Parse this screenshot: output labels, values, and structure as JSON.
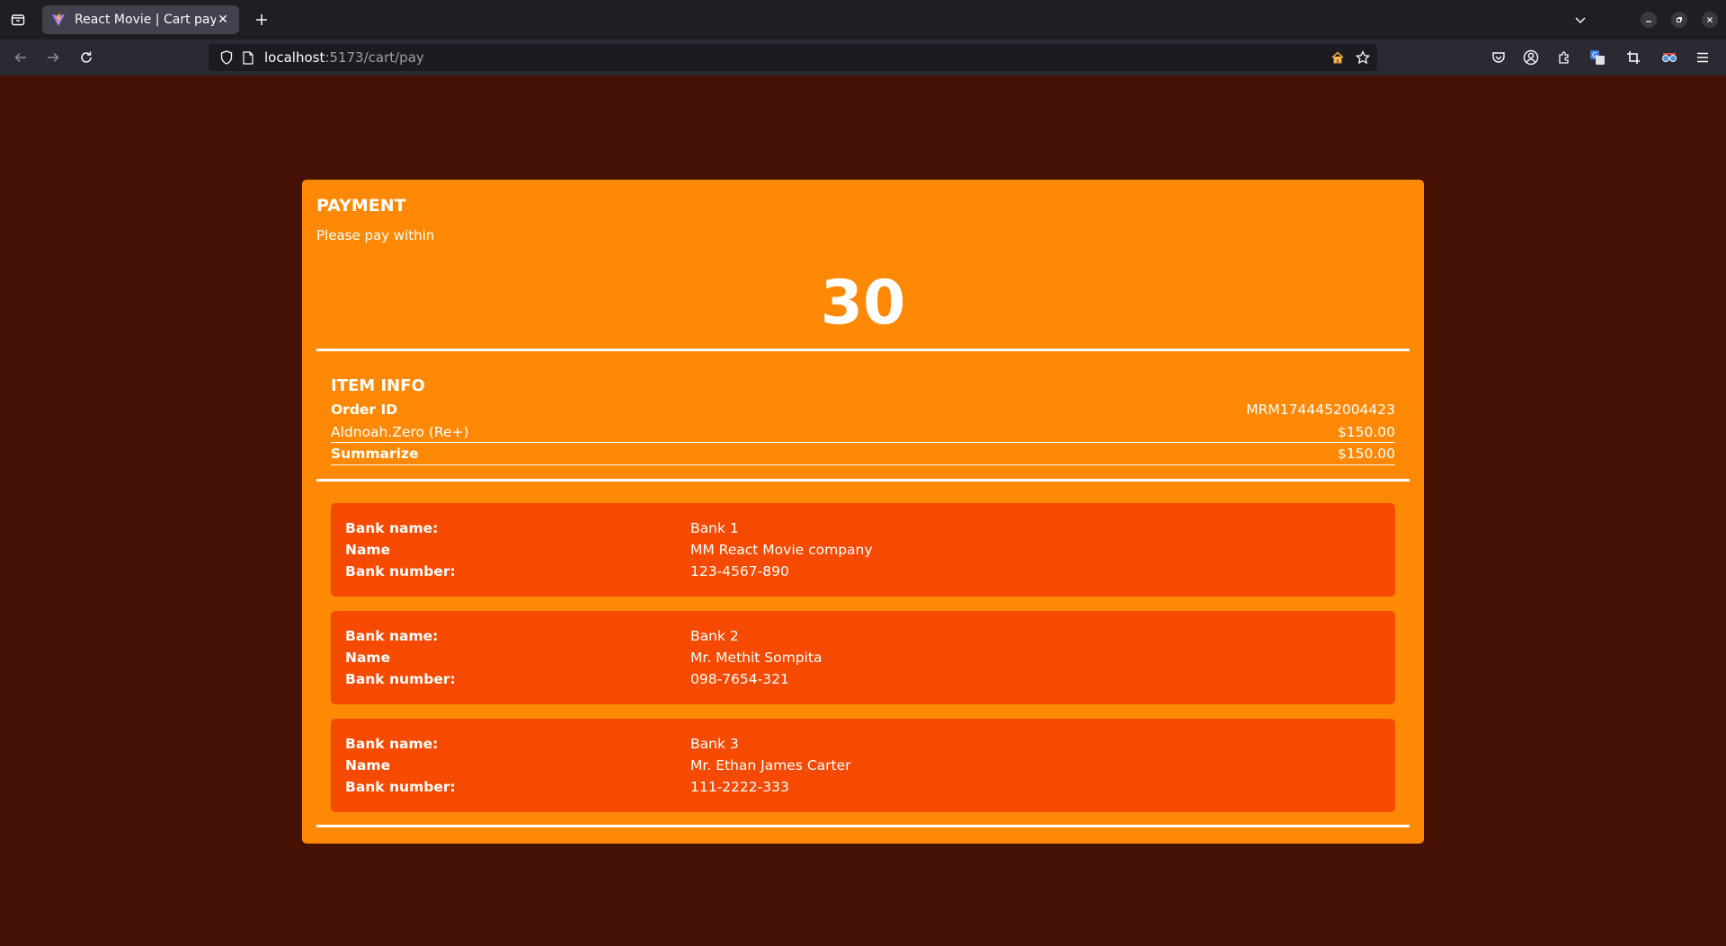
{
  "browser": {
    "tab_title": "React Movie | Cart pay",
    "url_host": "localhost",
    "url_rest": ":5173/cart/pay"
  },
  "payment": {
    "title": "PAYMENT",
    "subtitle": "Please pay within",
    "countdown": "30"
  },
  "item_info": {
    "title": "ITEM INFO",
    "order_label": "Order ID",
    "order_id": "MRM1744452004423",
    "items": [
      {
        "name": "Aldnoah.Zero (Re+)",
        "price": "$150.00"
      }
    ],
    "summary_label": "Summarize",
    "summary_value": "$150.00"
  },
  "banks": [
    {
      "bank_label": "Bank name:",
      "bank": "Bank 1",
      "name_label": "Name",
      "name": "MM React Movie company",
      "number_label": "Bank number:",
      "number": "123-4567-890"
    },
    {
      "bank_label": "Bank name:",
      "bank": "Bank 2",
      "name_label": "Name",
      "name": "Mr. Methit Sompita",
      "number_label": "Bank number:",
      "number": "098-7654-321"
    },
    {
      "bank_label": "Bank name:",
      "bank": "Bank 3",
      "name_label": "Name",
      "name": "Mr. Ethan James Carter",
      "number_label": "Bank number:",
      "number": "111-2222-333"
    }
  ],
  "colors": {
    "page_bg": "#451205",
    "card_bg": "#ff8904",
    "bank_bg": "#f54a00"
  }
}
